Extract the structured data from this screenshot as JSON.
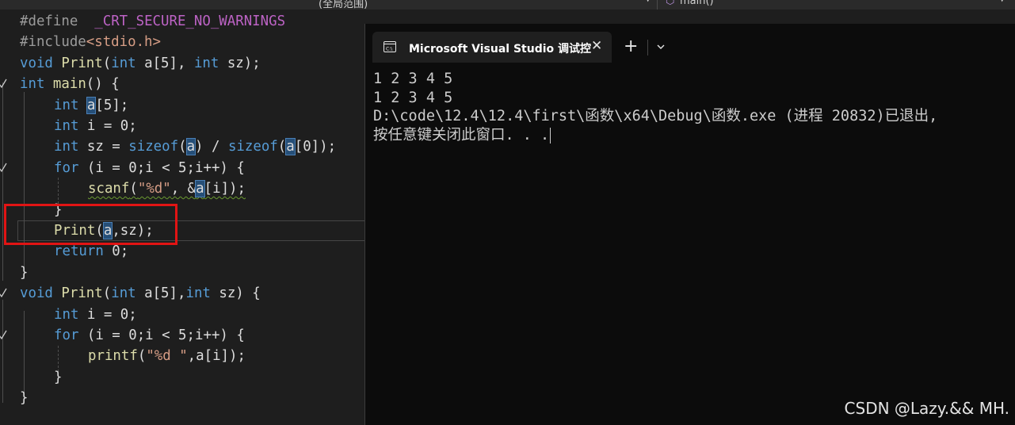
{
  "toolbar": {
    "scope": "(全局范围)",
    "member": "main()"
  },
  "code": {
    "l1_directive": "#define",
    "l1_macro": "_CRT_SECURE_NO_WARNINGS",
    "l2_directive": "#include",
    "l2_header": "<stdio.h>",
    "l3_kw": "void",
    "l3_fn": "Print",
    "l3_p1_kw": "int",
    "l3_p1_rest": " a[5], ",
    "l3_p2_kw": "int",
    "l3_p2_rest": " sz);",
    "l4_kw": "int",
    "l4_fn": "main",
    "l4_rest": "() {",
    "l5_kw": "int",
    "l5_var": "a",
    "l5_rest": "[5];",
    "l6_kw": "int",
    "l6_rest": " i = 0;",
    "l7_kw": "int",
    "l7_mid": " sz = ",
    "l7_sizeof1": "sizeof",
    "l7_var1": "a",
    "l7_mid2": ") / ",
    "l7_sizeof2": "sizeof",
    "l7_var2": "a",
    "l7_tail": "[0]);",
    "l8_kw": "for",
    "l8_rest": " (i = 0;i < 5;i++) {",
    "l9_fn": "scanf",
    "l9_str": "\"%d\"",
    "l9_mid": ", &",
    "l9_var": "a",
    "l9_tail": "[i]);",
    "l10_text": "}",
    "l11_fn": "Print",
    "l11_var": "a",
    "l11_tail": ",sz);",
    "l12_kw": "return",
    "l12_rest": " 0;",
    "l13_text": "}",
    "l14_kw": "void",
    "l14_fn": "Print",
    "l14_p1_kw": "int",
    "l14_p1_rest": " a[5],",
    "l14_p2_kw": "int",
    "l14_p2_rest": " sz) {",
    "l15_kw": "int",
    "l15_rest": " i = 0;",
    "l16_kw": "for",
    "l16_rest": " (i = 0;i < 5;i++) {",
    "l17_fn": "printf",
    "l17_str": "\"%d \"",
    "l17_tail": ",a[i]);",
    "l18_text": "}",
    "l19_text": "}"
  },
  "console": {
    "tab_title": "Microsoft Visual Studio 调试控",
    "close_glyph": "✕",
    "new_tab_glyph": "+",
    "output": [
      "1 2 3 4 5",
      "1 2 3 4 5",
      "D:\\code\\12.4\\12.4\\first\\函数\\x64\\Debug\\函数.exe (进程 20832)已退出,",
      "按任意键关闭此窗口. . ."
    ]
  },
  "watermark": "CSDN @Lazy.&& MH.",
  "colors": {
    "keyword": "#569cd6",
    "function": "#dcdcaa",
    "string": "#d69d85",
    "macro": "#bd63c5",
    "highlight_box": "#e11414"
  }
}
